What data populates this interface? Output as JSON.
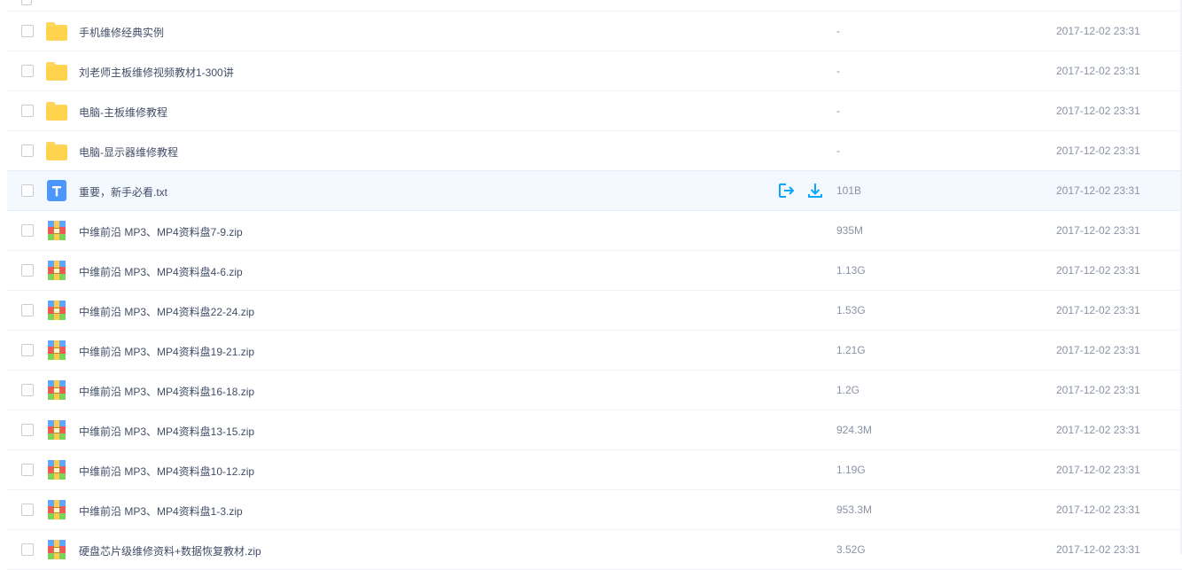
{
  "colors": {
    "accent": "#06a7ff",
    "folder": "#ffd65c",
    "txt_icon": "#4c97ff"
  },
  "rows": [
    {
      "icon": "folder-icon",
      "name": "手机维修经典实例",
      "size": "-",
      "time": "2017-12-02 23:31"
    },
    {
      "icon": "folder-icon",
      "name": "刘老师主板维修视频教材1-300讲",
      "size": "-",
      "time": "2017-12-02 23:31"
    },
    {
      "icon": "folder-icon",
      "name": "电脑-主板维修教程",
      "size": "-",
      "time": "2017-12-02 23:31"
    },
    {
      "icon": "folder-icon",
      "name": "电脑-显示器维修教程",
      "size": "-",
      "time": "2017-12-02 23:31"
    },
    {
      "icon": "txt-file-icon",
      "name": "重要，新手必看.txt",
      "size": "101B",
      "time": "2017-12-02 23:31"
    },
    {
      "icon": "zip-file-icon",
      "name": "中维前沿 MP3、MP4资料盘7-9.zip",
      "size": "935M",
      "time": "2017-12-02 23:31"
    },
    {
      "icon": "zip-file-icon",
      "name": "中维前沿 MP3、MP4资料盘4-6.zip",
      "size": "1.13G",
      "time": "2017-12-02 23:31"
    },
    {
      "icon": "zip-file-icon",
      "name": "中维前沿 MP3、MP4资料盘22-24.zip",
      "size": "1.53G",
      "time": "2017-12-02 23:31"
    },
    {
      "icon": "zip-file-icon",
      "name": "中维前沿 MP3、MP4资料盘19-21.zip",
      "size": "1.21G",
      "time": "2017-12-02 23:31"
    },
    {
      "icon": "zip-file-icon",
      "name": "中维前沿 MP3、MP4资料盘16-18.zip",
      "size": "1.2G",
      "time": "2017-12-02 23:31"
    },
    {
      "icon": "zip-file-icon",
      "name": "中维前沿 MP3、MP4资料盘13-15.zip",
      "size": "924.3M",
      "time": "2017-12-02 23:31"
    },
    {
      "icon": "zip-file-icon",
      "name": "中维前沿 MP3、MP4资料盘10-12.zip",
      "size": "1.19G",
      "time": "2017-12-02 23:31"
    },
    {
      "icon": "zip-file-icon",
      "name": "中维前沿 MP3、MP4资料盘1-3.zip",
      "size": "953.3M",
      "time": "2017-12-02 23:31"
    },
    {
      "icon": "zip-file-icon",
      "name": "硬盘芯片级维修资料+数据恢复教材.zip",
      "size": "3.52G",
      "time": "2017-12-02 23:31"
    }
  ]
}
